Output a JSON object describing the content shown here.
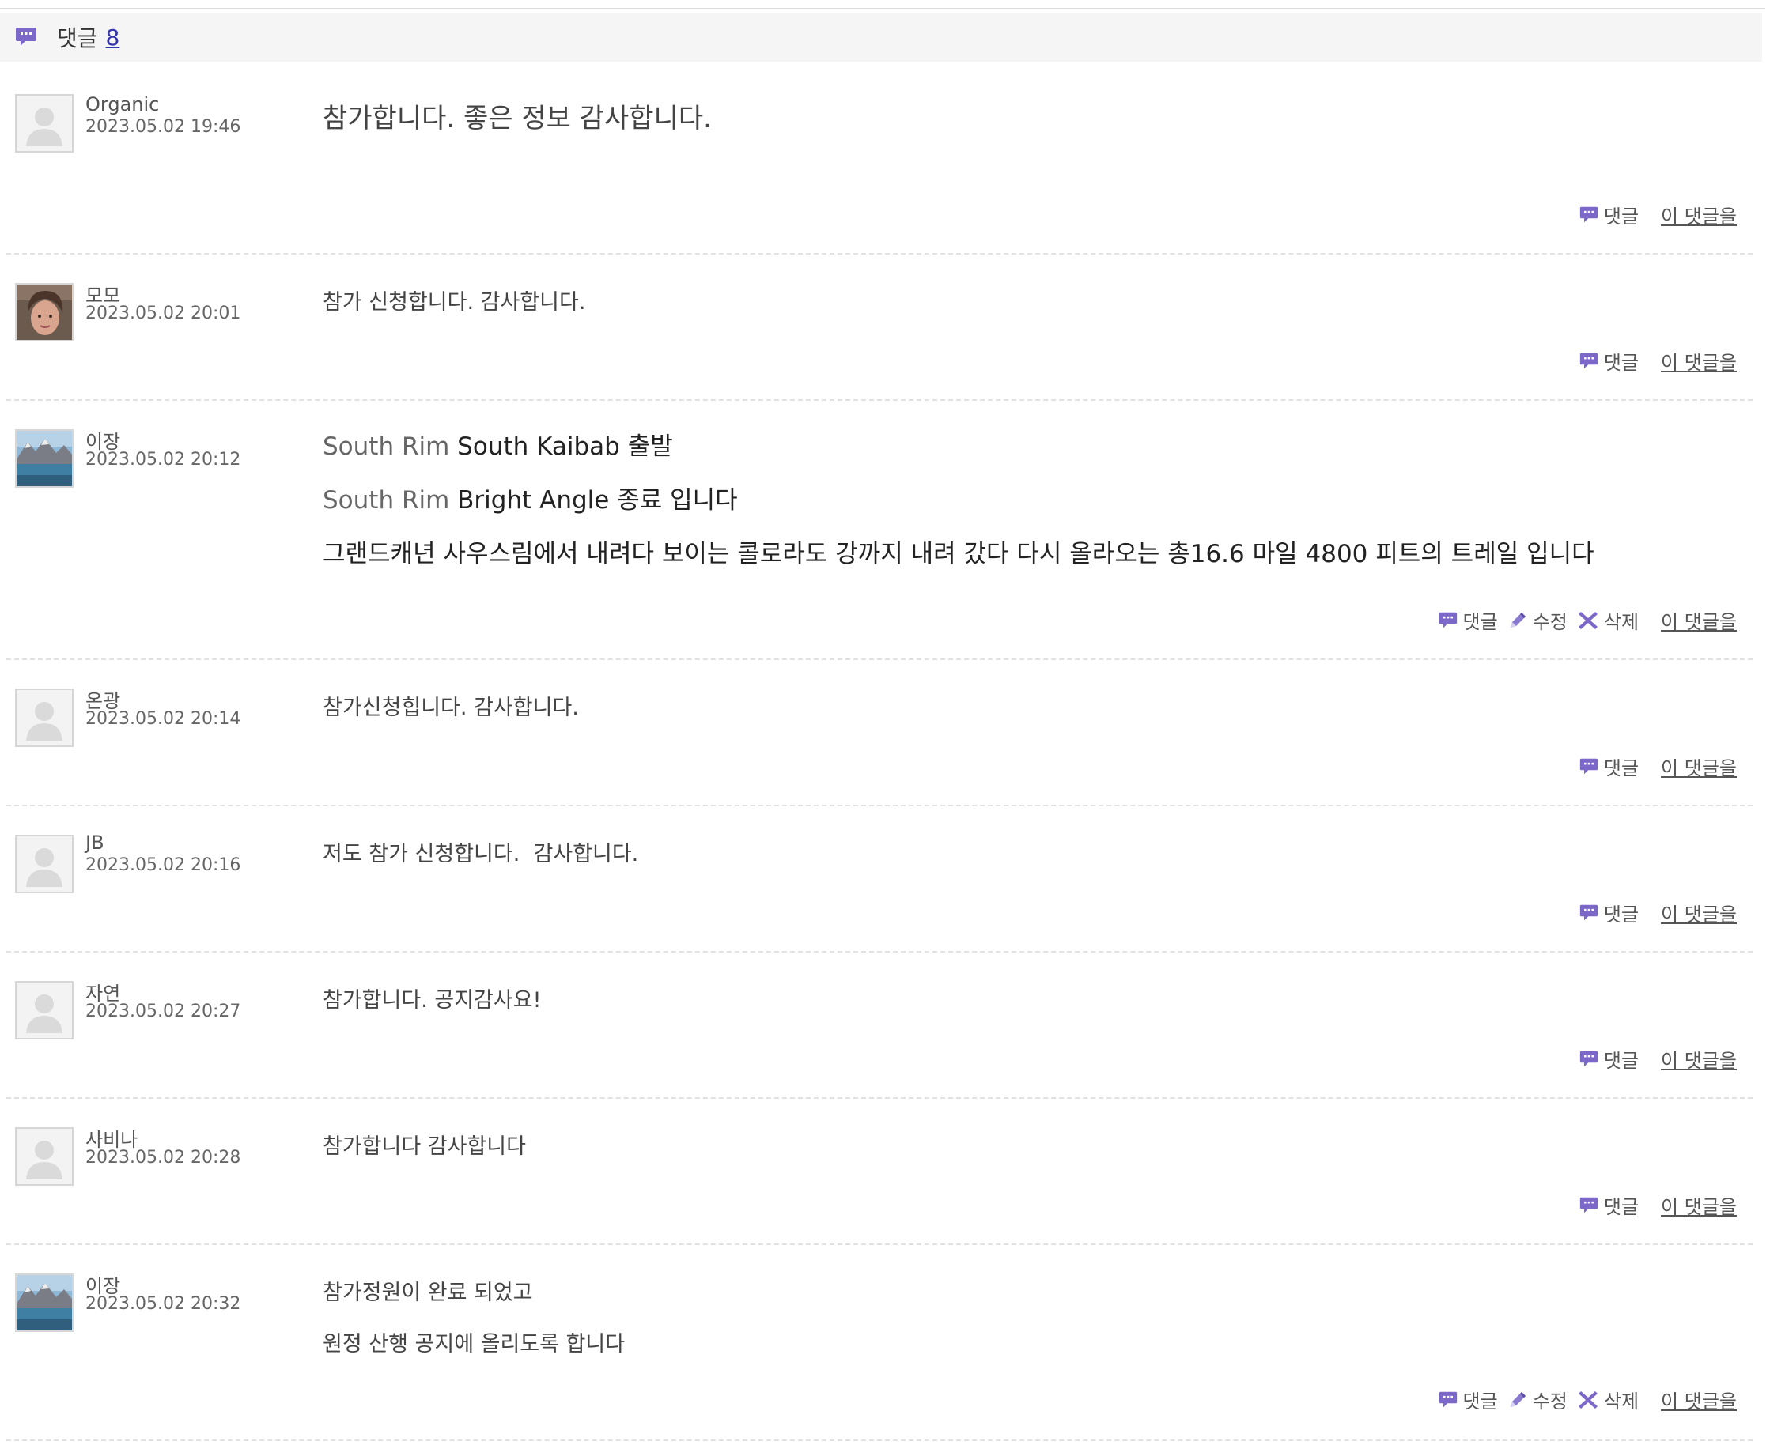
{
  "header": {
    "title": "댓글",
    "count": "8"
  },
  "labels": {
    "reply": "댓글",
    "edit": "수정",
    "delete": "삭제",
    "this_comment": "이 댓글을"
  },
  "colors": {
    "accent": "#7b68c8",
    "link": "#3333aa"
  },
  "comments": [
    {
      "author": "Organic",
      "date": "2023.05.02 19:46",
      "avatar": "default-avatar",
      "lines": [
        "참가합니다. 좋은 정보 감사합니다."
      ]
    },
    {
      "author": "모모",
      "date": "2023.05.02 20:01",
      "avatar": "photo-avatar-person",
      "lines": [
        "참가 신청합니다. 감사합니다."
      ]
    },
    {
      "author": "이장",
      "date": "2023.05.02 20:12",
      "avatar": "photo-avatar-landscape",
      "rich_lines": [
        {
          "gray": "South Rim",
          "dark": " South Kaibab 출발"
        },
        {
          "gray": "South Rim",
          "dark": " Bright Angle 종료 입니다"
        },
        {
          "gray": "",
          "dark": "그랜드캐년 사우스림에서 내려다 보이는 콜로라도 강까지 내려 갔다 다시 올라오는 총16.6 마일 4800 피트의 트레일 입니다"
        }
      ]
    },
    {
      "author": "온광",
      "date": "2023.05.02 20:14",
      "avatar": "default-avatar",
      "lines": [
        "참가신청힙니다. 감사합니다."
      ]
    },
    {
      "author": "JB",
      "date": "2023.05.02 20:16",
      "avatar": "default-avatar",
      "lines": [
        "저도 참가 신청합니다.  감사합니다."
      ]
    },
    {
      "author": "자연",
      "date": "2023.05.02 20:27",
      "avatar": "default-avatar",
      "lines": [
        "참가합니다. 공지감사요!"
      ]
    },
    {
      "author": "사비나",
      "date": "2023.05.02 20:28",
      "avatar": "default-avatar",
      "lines": [
        "참가합니다 감사합니다"
      ]
    },
    {
      "author": "이장",
      "date": "2023.05.02 20:32",
      "avatar": "photo-avatar-landscape",
      "lines": [
        "참가정원이 완료 되었고",
        "원정 산행 공지에 올리도록 합니다"
      ]
    }
  ]
}
